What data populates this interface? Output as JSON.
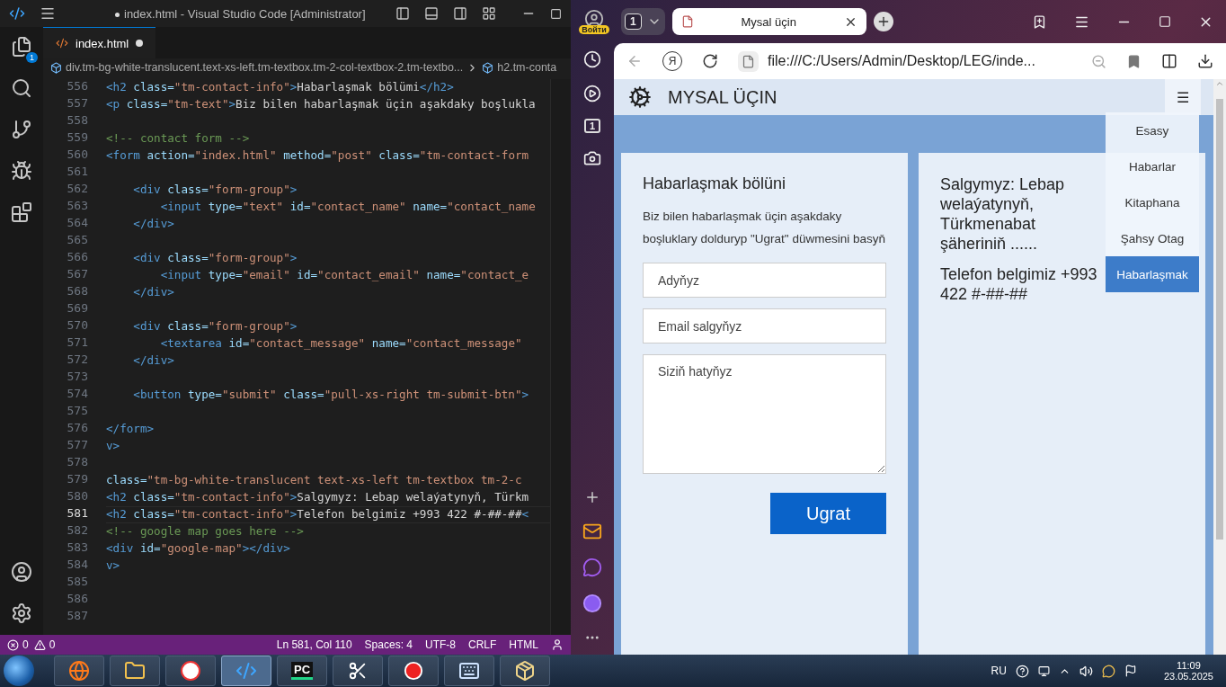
{
  "editor": {
    "title": "index.html - Visual Studio Code [Administrator]",
    "title_modified": true,
    "explorer_badge": "1",
    "tab": {
      "label": "index.html",
      "modified": true
    },
    "breadcrumb": [
      "div.tm-bg-white-translucent.text-xs-left.tm-textbox.tm-2-col-textbox-2.tm-textbo...",
      "h2.tm-conta"
    ],
    "lines": [
      {
        "number": "556",
        "current": false,
        "tokens": [
          {
            "kind": "tag",
            "text": "<h2"
          },
          {
            "kind": "attr",
            "text": " class="
          },
          {
            "kind": "string",
            "text": "\"tm-contact-info\""
          },
          {
            "kind": "tag",
            "text": ">"
          },
          {
            "kind": "text",
            "text": "Habarlaşmak bölümi"
          },
          {
            "kind": "tag",
            "text": "</h2>"
          }
        ]
      },
      {
        "number": "557",
        "current": false,
        "tokens": [
          {
            "kind": "tag",
            "text": "<p"
          },
          {
            "kind": "attr",
            "text": " class="
          },
          {
            "kind": "string",
            "text": "\"tm-text\""
          },
          {
            "kind": "tag",
            "text": ">"
          },
          {
            "kind": "text",
            "text": "Biz bilen habarlaşmak üçin aşakdaky boşlukla"
          }
        ]
      },
      {
        "number": "558",
        "current": false
      },
      {
        "number": "559",
        "current": false,
        "tokens": [
          {
            "kind": "comment",
            "text": "<!-- contact form -->"
          }
        ]
      },
      {
        "number": "560",
        "current": false,
        "tokens": [
          {
            "kind": "tag",
            "text": "<form"
          },
          {
            "kind": "attr",
            "text": " action="
          },
          {
            "kind": "string",
            "text": "\"index.html\""
          },
          {
            "kind": "attr",
            "text": " method="
          },
          {
            "kind": "string",
            "text": "\"post\""
          },
          {
            "kind": "attr",
            "text": " class="
          },
          {
            "kind": "string",
            "text": "\"tm-contact-form"
          }
        ]
      },
      {
        "number": "561",
        "current": false
      },
      {
        "number": "562",
        "current": false,
        "tokens": [
          {
            "kind": "tag",
            "text": "    <div"
          },
          {
            "kind": "attr",
            "text": " class="
          },
          {
            "kind": "string",
            "text": "\"form-group\""
          },
          {
            "kind": "tag",
            "text": ">"
          }
        ]
      },
      {
        "number": "563",
        "current": false,
        "tokens": [
          {
            "kind": "tag",
            "text": "        <input"
          },
          {
            "kind": "attr",
            "text": " type="
          },
          {
            "kind": "string",
            "text": "\"text\""
          },
          {
            "kind": "attr",
            "text": " id="
          },
          {
            "kind": "string",
            "text": "\"contact_name\""
          },
          {
            "kind": "attr",
            "text": " name="
          },
          {
            "kind": "string",
            "text": "\"contact_name"
          }
        ]
      },
      {
        "number": "564",
        "current": false,
        "tokens": [
          {
            "kind": "tag",
            "text": "    </div>"
          }
        ]
      },
      {
        "number": "565",
        "current": false
      },
      {
        "number": "566",
        "current": false,
        "tokens": [
          {
            "kind": "tag",
            "text": "    <div"
          },
          {
            "kind": "attr",
            "text": " class="
          },
          {
            "kind": "string",
            "text": "\"form-group\""
          },
          {
            "kind": "tag",
            "text": ">"
          }
        ]
      },
      {
        "number": "567",
        "current": false,
        "tokens": [
          {
            "kind": "tag",
            "text": "        <input"
          },
          {
            "kind": "attr",
            "text": " type="
          },
          {
            "kind": "string",
            "text": "\"email\""
          },
          {
            "kind": "attr",
            "text": " id="
          },
          {
            "kind": "string",
            "text": "\"contact_email\""
          },
          {
            "kind": "attr",
            "text": " name="
          },
          {
            "kind": "string",
            "text": "\"contact_e"
          }
        ]
      },
      {
        "number": "568",
        "current": false,
        "tokens": [
          {
            "kind": "tag",
            "text": "    </div>"
          }
        ]
      },
      {
        "number": "569",
        "current": false
      },
      {
        "number": "570",
        "current": false,
        "tokens": [
          {
            "kind": "tag",
            "text": "    <div"
          },
          {
            "kind": "attr",
            "text": " class="
          },
          {
            "kind": "string",
            "text": "\"form-group\""
          },
          {
            "kind": "tag",
            "text": ">"
          }
        ]
      },
      {
        "number": "571",
        "current": false,
        "tokens": [
          {
            "kind": "tag",
            "text": "        <textarea"
          },
          {
            "kind": "attr",
            "text": " id="
          },
          {
            "kind": "string",
            "text": "\"contact_message\""
          },
          {
            "kind": "attr",
            "text": " name="
          },
          {
            "kind": "string",
            "text": "\"contact_message\""
          }
        ]
      },
      {
        "number": "572",
        "current": false,
        "tokens": [
          {
            "kind": "tag",
            "text": "    </div>"
          }
        ]
      },
      {
        "number": "573",
        "current": false
      },
      {
        "number": "574",
        "current": false,
        "tokens": [
          {
            "kind": "tag",
            "text": "    <button"
          },
          {
            "kind": "attr",
            "text": " type="
          },
          {
            "kind": "string",
            "text": "\"submit\""
          },
          {
            "kind": "attr",
            "text": " class="
          },
          {
            "kind": "string",
            "text": "\"pull-xs-right tm-submit-btn\""
          },
          {
            "kind": "tag",
            "text": ">"
          }
        ]
      },
      {
        "number": "575",
        "current": false
      },
      {
        "number": "576",
        "current": false,
        "tokens": [
          {
            "kind": "tag",
            "text": "</form>"
          }
        ]
      },
      {
        "number": "577",
        "current": false,
        "tokens": [
          {
            "kind": "tag",
            "text": "v>"
          }
        ]
      },
      {
        "number": "578",
        "current": false
      },
      {
        "number": "579",
        "current": false,
        "tokens": [
          {
            "kind": "attr",
            "text": "class="
          },
          {
            "kind": "string",
            "text": "\"tm-bg-white-translucent text-xs-left tm-textbox tm-2-c"
          }
        ]
      },
      {
        "number": "580",
        "current": false,
        "tokens": [
          {
            "kind": "tag",
            "text": "<h2"
          },
          {
            "kind": "attr",
            "text": " class="
          },
          {
            "kind": "string",
            "text": "\"tm-contact-info\""
          },
          {
            "kind": "tag",
            "text": ">"
          },
          {
            "kind": "text",
            "text": "Salgymyz: Lebap welaýatynyň, Türkm"
          }
        ]
      },
      {
        "number": "581",
        "current": true,
        "tokens": [
          {
            "kind": "tag",
            "text": "<h2"
          },
          {
            "kind": "attr",
            "text": " class="
          },
          {
            "kind": "string",
            "text": "\"tm-contact-info\""
          },
          {
            "kind": "tag",
            "text": ">"
          },
          {
            "kind": "text",
            "text": "Telefon belgimiz +993 422 #-##-##"
          },
          {
            "kind": "tag",
            "text": "<"
          }
        ]
      },
      {
        "number": "582",
        "current": false,
        "tokens": [
          {
            "kind": "comment",
            "text": "<!-- google map goes here -->"
          }
        ]
      },
      {
        "number": "583",
        "current": false,
        "tokens": [
          {
            "kind": "tag",
            "text": "<div"
          },
          {
            "kind": "attr",
            "text": " id="
          },
          {
            "kind": "string",
            "text": "\"google-map\""
          },
          {
            "kind": "tag",
            "text": "></div>"
          }
        ]
      },
      {
        "number": "584",
        "current": false,
        "tokens": [
          {
            "kind": "tag",
            "text": "v>"
          }
        ]
      },
      {
        "number": "585",
        "current": false
      },
      {
        "number": "586",
        "current": false
      },
      {
        "number": "587",
        "current": false
      }
    ]
  },
  "status_bar": {
    "errors": "0",
    "warnings": "0",
    "items": [
      "Ln 581, Col 110",
      "Spaces: 4",
      "UTF-8",
      "CRLF",
      "HTML"
    ]
  },
  "browser": {
    "login": "Войти",
    "tab_count": "1",
    "tab": {
      "title": "Mysal üçin"
    },
    "logo": "Я",
    "url": "file:///C:/Users/Admin/Desktop/LEG/inde...",
    "sidebar_badge": "1",
    "page": {
      "site_title": "MYSAL ÜÇIN",
      "menu_button": "☰",
      "menu": [
        {
          "label": "Esasy",
          "selected": false
        },
        {
          "label": "Habarlar",
          "selected": false
        },
        {
          "label": "Kitaphana",
          "selected": false
        },
        {
          "label": "Şahsy Otag",
          "selected": false
        },
        {
          "label": "Habarlaşmak",
          "selected": true
        }
      ],
      "contact": {
        "heading": "Habarlaşmak bölüni",
        "text": "Biz bilen habarlaşmak üçin aşakdaky boşluklary dolduryp \"Ugrat\" düwmesini basyň",
        "fields": [
          {
            "kind": "input",
            "placeholder": "Adyňyz"
          },
          {
            "kind": "input",
            "placeholder": "Email salgyňyz"
          },
          {
            "kind": "textarea",
            "placeholder": "Siziň hatyňyz"
          }
        ],
        "submit": "Ugrat"
      },
      "info": [
        "Salgymyz: Lebap welaýatynyň, Türkmenabat şäheriniň ......",
        "Telefon belgimiz +993 422 #-##-##"
      ]
    }
  },
  "taskbar": {
    "apps": [
      {
        "kind": "firefox",
        "active": false
      },
      {
        "kind": "folder",
        "active": false
      },
      {
        "kind": "yandex",
        "active": false
      },
      {
        "kind": "vscode",
        "active": true
      },
      {
        "kind": "pycharm",
        "active": false,
        "label": "PC"
      },
      {
        "kind": "scissors",
        "active": false
      },
      {
        "kind": "record",
        "active": false
      },
      {
        "kind": "keyboard",
        "active": false
      },
      {
        "kind": "package",
        "active": false
      }
    ],
    "language": "RU",
    "time": "11:09",
    "date": "23.05.2025"
  }
}
